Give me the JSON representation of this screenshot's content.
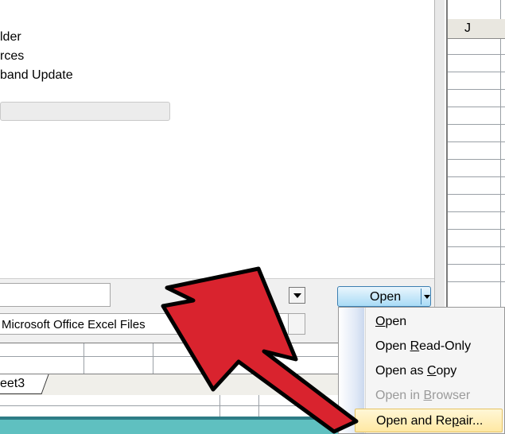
{
  "sheet": {
    "column_header": "J",
    "tab_label": "eet3"
  },
  "dialog": {
    "places": [
      "lder",
      "rces",
      "band Update"
    ],
    "file_type": "Microsoft Office Excel Files"
  },
  "open_button": {
    "label": "Open"
  },
  "menu": {
    "items": [
      {
        "pre": "",
        "u": "O",
        "post": "pen",
        "enabled": true
      },
      {
        "pre": "Open ",
        "u": "R",
        "post": "ead-Only",
        "enabled": true
      },
      {
        "pre": "Open as ",
        "u": "C",
        "post": "opy",
        "enabled": true
      },
      {
        "pre": "Open in ",
        "u": "B",
        "post": "rowser",
        "enabled": false
      },
      {
        "pre": "Open and Re",
        "u": "p",
        "post": "air...",
        "enabled": true
      }
    ]
  },
  "colors": {
    "arrow": "#d9232e",
    "highlight": "#ffe8a3",
    "status": "#5fc0c0"
  }
}
